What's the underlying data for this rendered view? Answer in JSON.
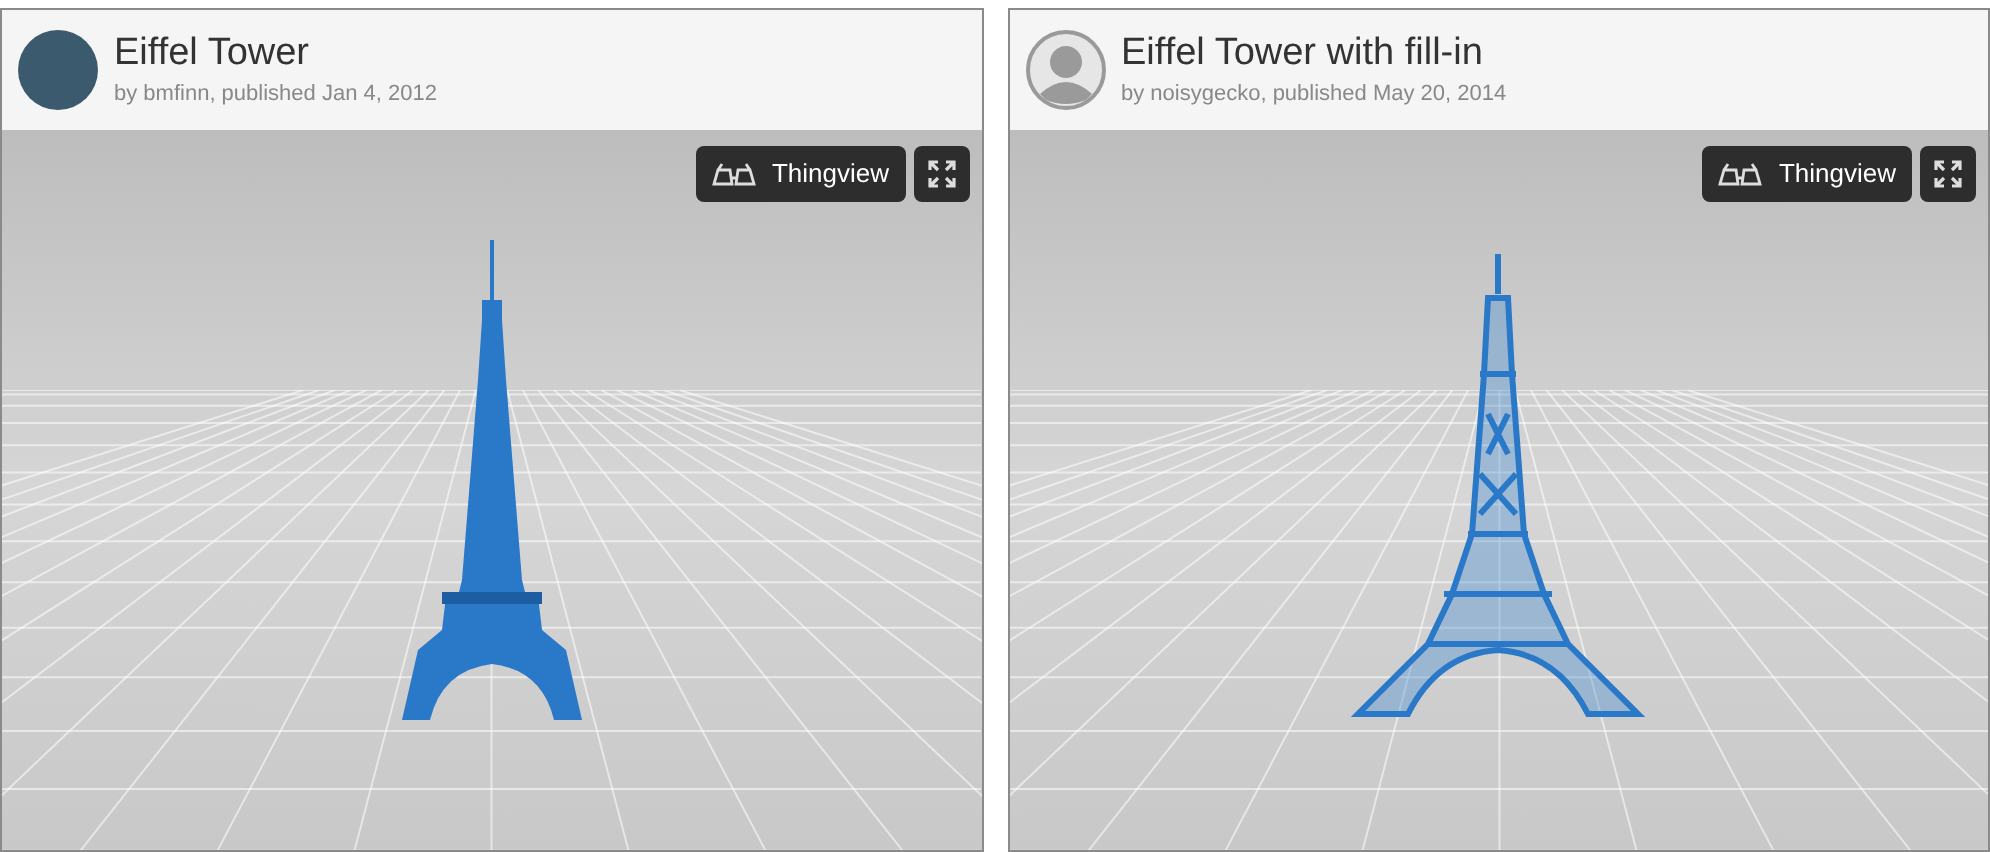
{
  "panels": [
    {
      "title": "Eiffel Tower",
      "byline": "by bmfinn, published Jan 4, 2012",
      "avatar": {
        "kind": "photo"
      },
      "viewer_button": "Thingview",
      "model": {
        "kind": "solid"
      }
    },
    {
      "title": "Eiffel Tower with fill-in",
      "byline": "by noisygecko, published May 20, 2014",
      "avatar": {
        "kind": "default"
      },
      "viewer_button": "Thingview",
      "model": {
        "kind": "lattice"
      }
    }
  ]
}
